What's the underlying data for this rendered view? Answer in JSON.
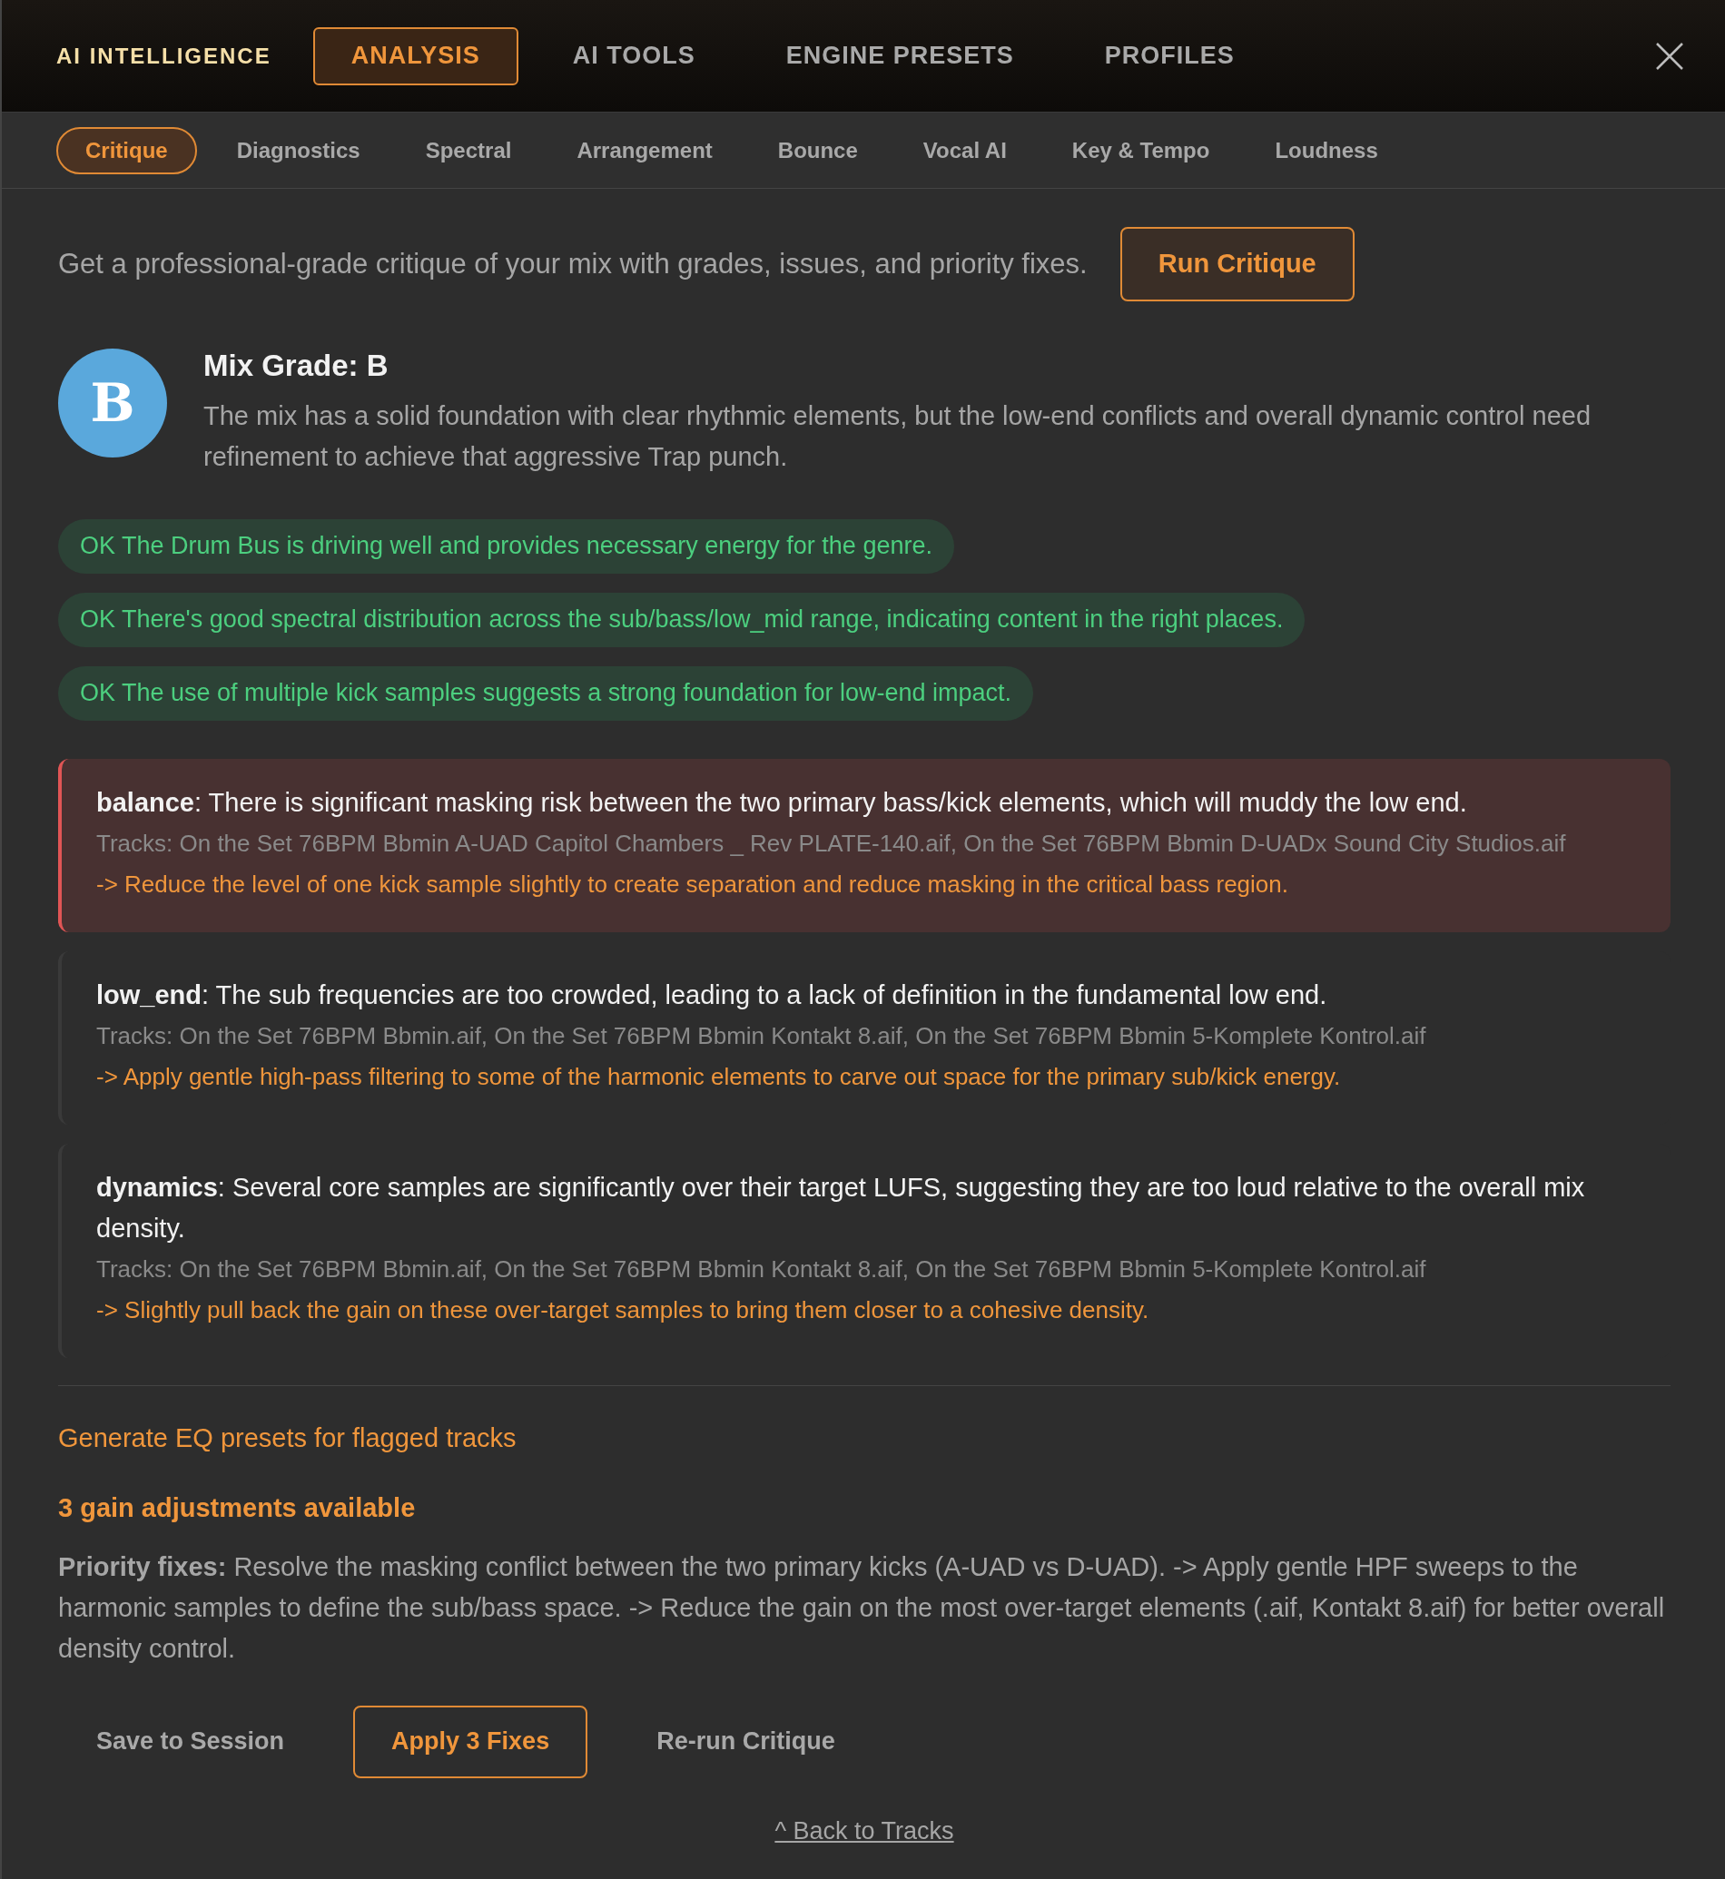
{
  "header": {
    "brand": "AI INTELLIGENCE",
    "tabs": [
      {
        "label": "ANALYSIS",
        "selected": true
      },
      {
        "label": "AI TOOLS",
        "selected": false
      },
      {
        "label": "ENGINE PRESETS",
        "selected": false
      },
      {
        "label": "PROFILES",
        "selected": false
      }
    ]
  },
  "subtabs": [
    {
      "label": "Critique",
      "selected": true
    },
    {
      "label": "Diagnostics",
      "selected": false
    },
    {
      "label": "Spectral",
      "selected": false
    },
    {
      "label": "Arrangement",
      "selected": false
    },
    {
      "label": "Bounce",
      "selected": false
    },
    {
      "label": "Vocal AI",
      "selected": false
    },
    {
      "label": "Key & Tempo",
      "selected": false
    },
    {
      "label": "Loudness",
      "selected": false
    }
  ],
  "intro": {
    "text": "Get a professional-grade critique of your mix with grades, issues, and priority fixes.",
    "button": "Run Critique"
  },
  "grade": {
    "letter": "B",
    "title": "Mix Grade: B",
    "summary": "The mix has a solid foundation with clear rhythmic elements, but the low-end conflicts and overall dynamic control need refinement to achieve that aggressive Trap punch."
  },
  "strengths": [
    "OK The Drum Bus is driving well and provides necessary energy for the genre.",
    "OK There's good spectral distribution across the sub/bass/low_mid range, indicating content in the right places.",
    "OK The use of multiple kick samples suggests a strong foundation for low-end impact."
  ],
  "issues": [
    {
      "kind": "high",
      "text": "**balance**: There is significant masking risk between the two primary bass/kick elements, which will muddy the low end.",
      "tracks": "Tracks: On the Set 76BPM Bbmin A-UAD Capitol Chambers _ Rev PLATE-140.aif, On the Set 76BPM Bbmin D-UADx Sound City Studios.aif",
      "fix": "-> Reduce the level of one kick sample slightly to create separation and reduce masking in the critical bass region."
    },
    {
      "kind": "normal",
      "text": "**low_end**: The sub frequencies are too crowded, leading to a lack of definition in the fundamental low end.",
      "tracks": "Tracks: On the Set 76BPM Bbmin.aif, On the Set 76BPM Bbmin Kontakt 8.aif, On the Set 76BPM Bbmin 5-Komplete Kontrol.aif",
      "fix": "-> Apply gentle high-pass filtering to some of the harmonic elements to carve out space for the primary sub/kick energy."
    },
    {
      "kind": "normal",
      "text": "**dynamics**: Several core samples are significantly over their target LUFS, suggesting they are too loud relative to the overall mix density.",
      "tracks": "Tracks: On the Set 76BPM Bbmin.aif, On the Set 76BPM Bbmin Kontakt 8.aif, On the Set 76BPM Bbmin 5-Komplete Kontrol.aif",
      "fix": "-> Slightly pull back the gain on these over-target samples to bring them closer to a cohesive density."
    }
  ],
  "eq_link": "Generate EQ presets for flagged tracks",
  "gain_note": "3 gain adjustments available",
  "priority": "**Priority fixes:** Resolve the masking conflict between the two primary kicks (A-UAD vs D-UAD). -> Apply gentle HPF sweeps to the harmonic samples to define the sub/bass space. -> Reduce the gain on the most over-target elements (.aif, Kontakt 8.aif) for better overall density control.",
  "actions": [
    {
      "label": "Save to Session",
      "kind": "plain"
    },
    {
      "label": "Apply 3 Fixes",
      "kind": "primary"
    },
    {
      "label": "Re-run Critique",
      "kind": "plain"
    }
  ],
  "back_link": "^ Back to Tracks"
}
